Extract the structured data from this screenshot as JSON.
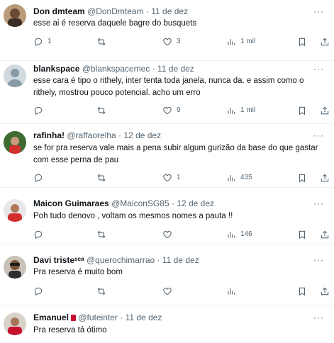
{
  "tweets": [
    {
      "name": "Don dmteam",
      "handle": "@DonDmteam",
      "time": "11 de dez",
      "text": "esse ai é reserva daquele bagre do busquets",
      "replies": "1",
      "retweets": "",
      "likes": "3",
      "views": "1 mil"
    },
    {
      "name": "blankspace",
      "handle": "@blankspacemec",
      "time": "11 de dez",
      "text": "esse cara é tipo o rithely, inter tenta toda janela, nunca da. e assim como o rithely, mostrou pouco potencial. acho um erro",
      "replies": "",
      "retweets": "",
      "likes": "9",
      "views": "1 mil"
    },
    {
      "name": "rafinha!",
      "handle": "@raffaorelha",
      "time": "12 de dez",
      "text": "se for pra reserva vale mais a pena subir algum gurizão da base do que gastar com esse perna de pau",
      "replies": "",
      "retweets": "",
      "likes": "1",
      "views": "435"
    },
    {
      "name": "Maicon Guimaraes",
      "handle": "@MaiconSG85",
      "time": "12 de dez",
      "text": "Poh tudo denovo , voltam os mesmos nomes a pauta !!",
      "replies": "",
      "retweets": "",
      "likes": "",
      "views": "146"
    },
    {
      "name": "Davi tristeˢᶜᵃ",
      "handle": "@querochimarrao",
      "time": "11 de dez",
      "text": "Pra reserva é muito bom",
      "replies": "",
      "retweets": "",
      "likes": "",
      "views": ""
    },
    {
      "name": "Emanuel",
      "handle": "@futeinter",
      "time": "11 de dez",
      "text": "Pra reserva tá ótimo",
      "replies": "",
      "retweets": "",
      "likes": "",
      "views": ""
    }
  ],
  "separator": "·",
  "more_label": "···",
  "icons": {
    "reply": "reply-icon",
    "retweet": "retweet-icon",
    "like": "heart-icon",
    "views": "views-icon",
    "bookmark": "bookmark-icon",
    "share": "share-icon"
  },
  "colors": {
    "text": "#0f1419",
    "secondary": "#536471",
    "divider": "#eff3f4",
    "flag_red": "#c8102e"
  }
}
